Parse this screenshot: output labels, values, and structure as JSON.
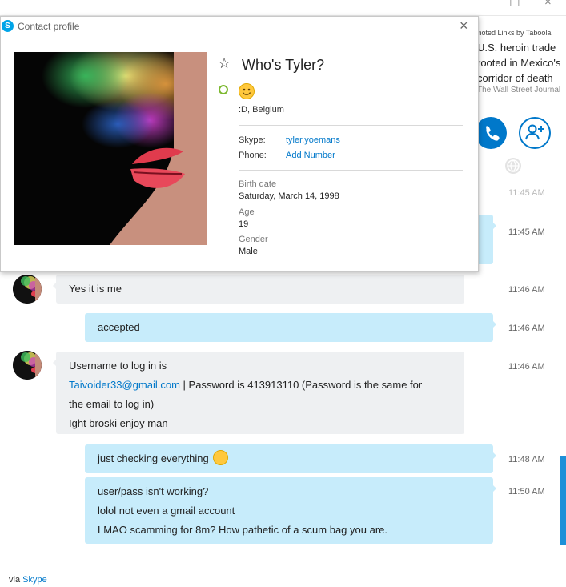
{
  "window": {
    "maximize_glyph": "☐",
    "close_glyph": "×"
  },
  "ad": {
    "source": "moted Links by Taboola",
    "title": "U.S. heroin trade rooted in Mexico's corridor of death",
    "publisher": "The Wall Street Journal"
  },
  "icons": {
    "call": "phone-icon",
    "add_contact": "add-contact-icon",
    "globe": "globe-icon",
    "star": "star-icon",
    "close": "close-icon",
    "skype_logo": "skype-logo-icon"
  },
  "colors": {
    "accent": "#0078ca",
    "outgoing_bubble": "#c7ecfb",
    "incoming_bubble": "#eef0f2",
    "presence": "#7cb82f"
  },
  "profile": {
    "window_title": "Contact profile",
    "close_glyph": "×",
    "star_glyph": "☆",
    "name": "Who's Tyler?",
    "location": ":D, Belgium",
    "skype_label": "Skype:",
    "skype_value": "tyler.yoemans",
    "phone_label": "Phone:",
    "phone_value": "Add Number",
    "birth_label": "Birth date",
    "birth_value": "Saturday, March 14, 1998",
    "age_label": "Age",
    "age_value": "19",
    "gender_label": "Gender",
    "gender_value": "Male"
  },
  "messages": [
    {
      "direction": "out",
      "time": "11:45 AM"
    },
    {
      "direction": "out",
      "time": "11:45 AM"
    },
    {
      "direction": "in",
      "text": "Yes it is me",
      "time": "11:46 AM"
    },
    {
      "direction": "out",
      "text": "accepted",
      "time": "11:46 AM"
    },
    {
      "direction": "in",
      "line1": "Username to log in is",
      "email": "Taivoider33@gmail.com",
      "line2_rest": " | Password is 413913110 (Password is the same for",
      "line3": "the email to log in)",
      "line4": "Ight broski enjoy man",
      "time": "11:46 AM"
    },
    {
      "direction": "out",
      "text": "just checking everything",
      "time": "11:48 AM"
    },
    {
      "direction": "out",
      "line1": "user/pass isn't working?",
      "line2": "lolol not even a gmail account",
      "line3": "LMAO scamming for 8m? How pathetic of a scum bag you are.",
      "time": "11:50 AM"
    }
  ],
  "footer": {
    "via": "via",
    "via_link": "Skype"
  }
}
